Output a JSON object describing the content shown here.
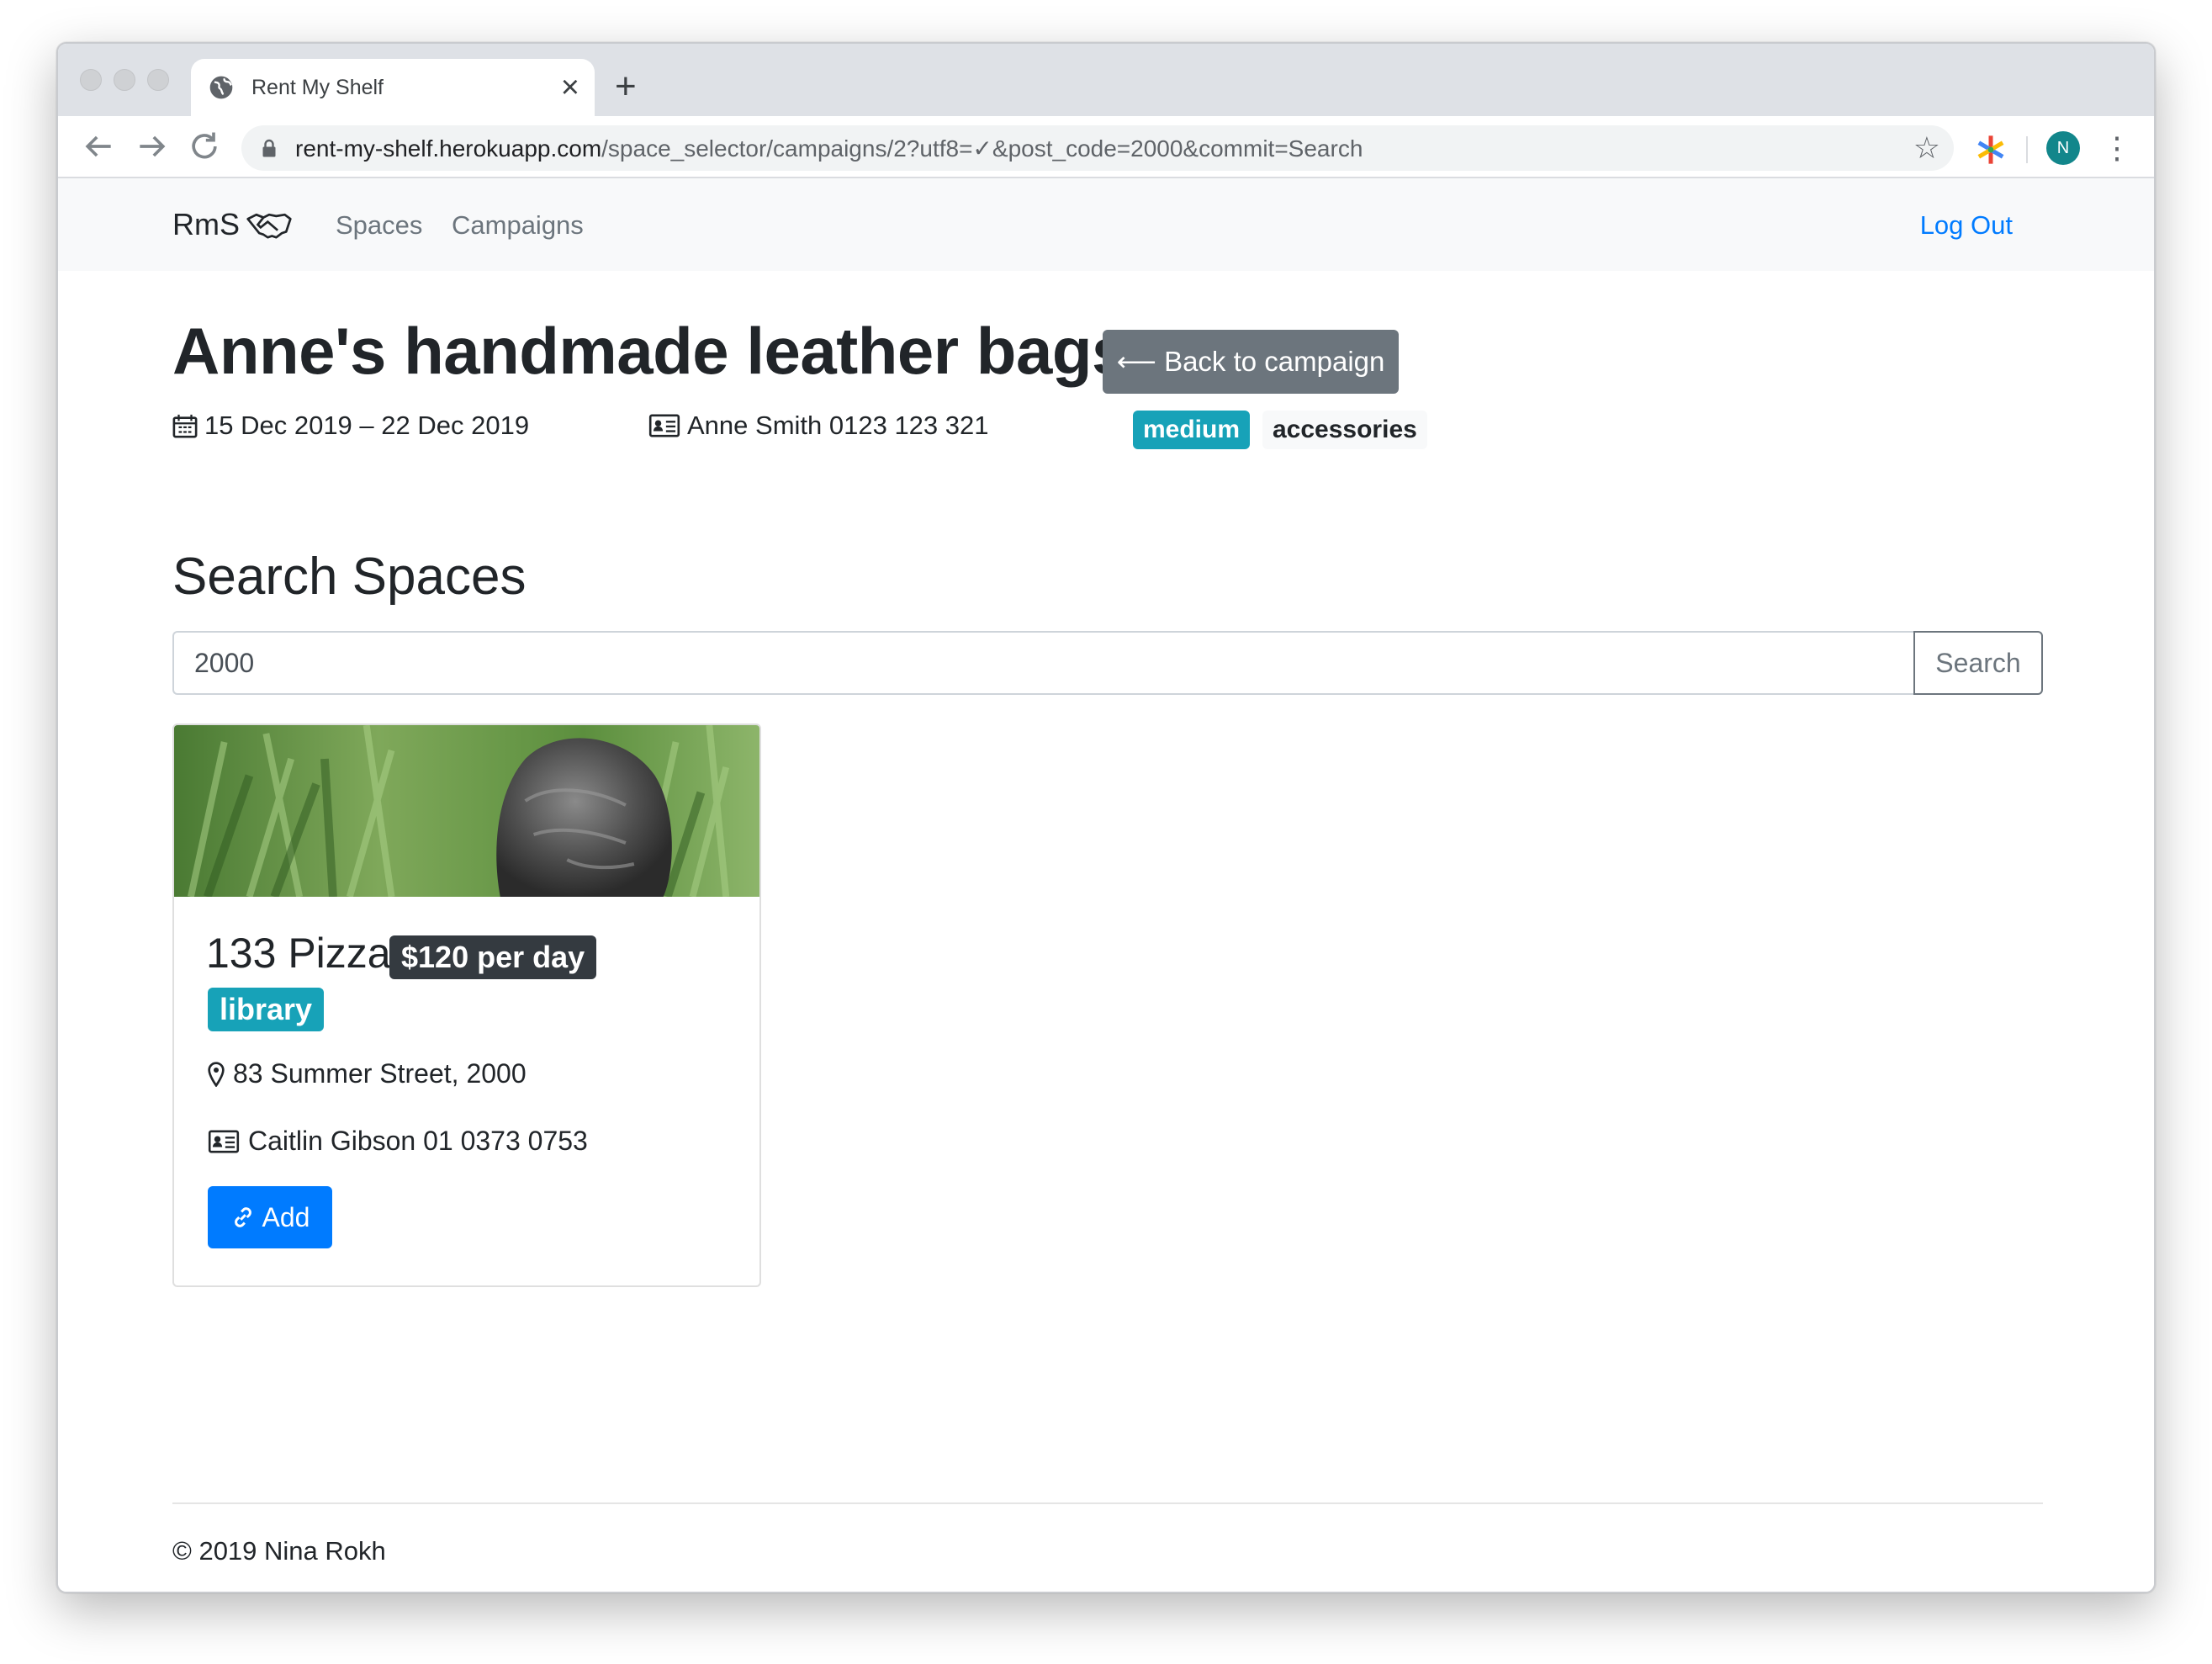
{
  "browser": {
    "tab_title": "Rent My Shelf",
    "new_tab_symbol": "+",
    "close_symbol": "×",
    "url_host": "rent-my-shelf.herokuapp.com",
    "url_path": "/space_selector/campaigns/2?utf8=✓&post_code=2000&commit=Search",
    "profile_initial": "N",
    "icons": [
      "globe-icon",
      "back-arrow-icon",
      "forward-arrow-icon",
      "reload-icon",
      "lock-icon",
      "bookmark-star-icon",
      "extension-icon",
      "menu-kebab-icon"
    ]
  },
  "navbar": {
    "brand": "RmS",
    "brand_icon": "handshake-icon",
    "links": [
      "Spaces",
      "Campaigns"
    ],
    "logout": "Log Out"
  },
  "campaign": {
    "title": "Anne's handmade leather bags",
    "back_button": "⟵ Back to campaign",
    "dates": "15 Dec 2019 – 22 Dec 2019",
    "contact": "Anne Smith 0123 123 321",
    "size_badge": "medium",
    "category_badge": "accessories"
  },
  "search": {
    "heading": "Search Spaces",
    "value": "2000",
    "button": "Search"
  },
  "results": [
    {
      "name": "133 Pizza",
      "price": "$120 per day",
      "type": "library",
      "address": "83 Summer Street, 2000",
      "contact": "Caitlin Gibson 01 0373 0753",
      "action": "Add"
    }
  ],
  "footer": {
    "text": "© 2019 Nina Rokh"
  },
  "colors": {
    "primary": "#007bff",
    "secondary": "#6c757d",
    "info": "#17a2b8",
    "dark": "#343a40"
  }
}
